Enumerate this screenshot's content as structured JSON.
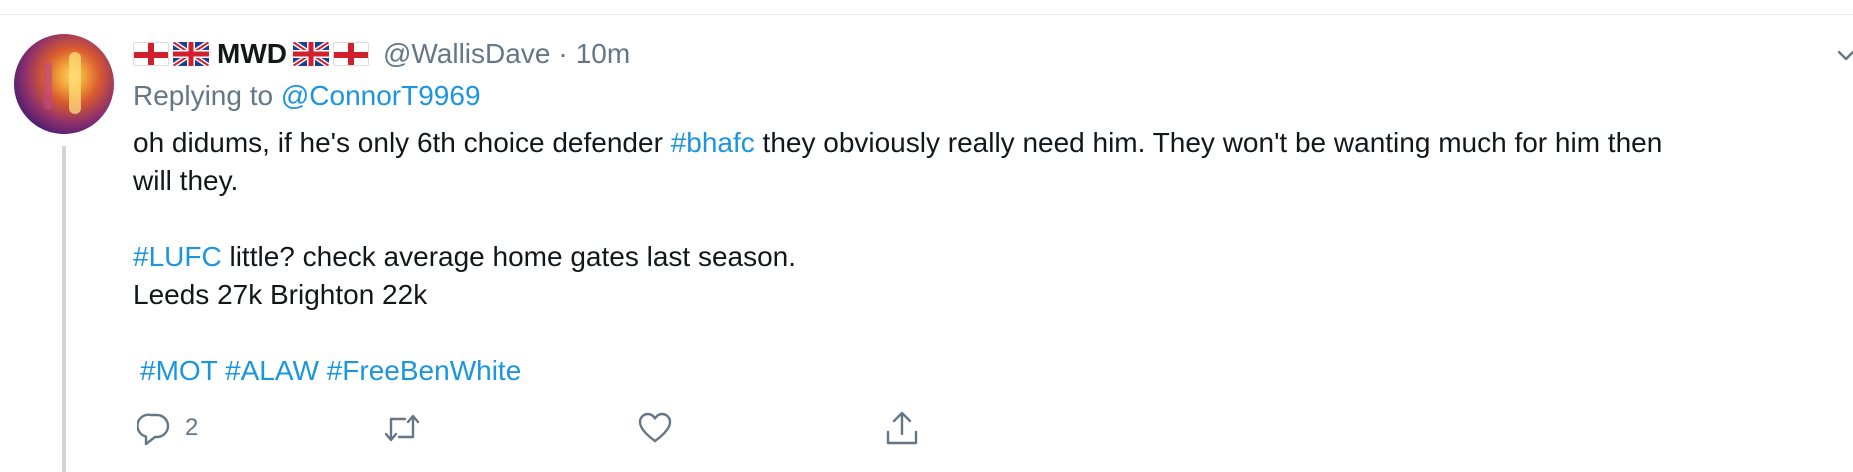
{
  "tweet": {
    "display_name": "MWD",
    "handle": "@WallisDave",
    "separator": "·",
    "time": "10m",
    "replying_prefix": "Replying to",
    "replying_to": "@ConnorT9969",
    "line1_a": "oh didums, if he's only 6th choice defender ",
    "line1_hashtag": "#bhafc",
    "line1_b": " they obviously really need him. They won't be wanting much for him then",
    "line2": "will they.",
    "line3_hashtag": "#LUFC",
    "line3_rest": " little?  check average home gates last season.",
    "line4": "Leeds 27k Brighton 22k",
    "tags": [
      "#MOT",
      "#ALAW",
      "#FreeBenWhite"
    ],
    "reply_count": "2"
  },
  "colors": {
    "accent": "#1b95e0",
    "muted": "#657786",
    "text": "#14171a",
    "thread_line": "#ccd6dd"
  },
  "icons": [
    "england-flag-icon",
    "uk-flag-icon",
    "chevron-down-icon",
    "reply-icon",
    "retweet-icon",
    "like-icon",
    "share-icon"
  ]
}
